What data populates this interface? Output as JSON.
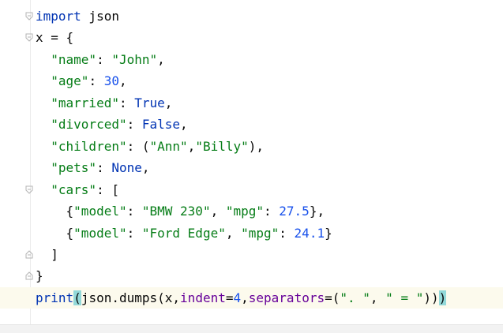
{
  "code_lines": [
    "import json",
    "x = {",
    "  \"name\": \"John\",",
    "  \"age\": 30,",
    "  \"married\": True,",
    "  \"divorced\": False,",
    "  \"children\": (\"Ann\",\"Billy\"),",
    "  \"pets\": None,",
    "  \"cars\": [",
    "    {\"model\": \"BMW 230\", \"mpg\": 27.5},",
    "    {\"model\": \"Ford Edge\", \"mpg\": 24.1}",
    "  ]",
    "}",
    "print(json.dumps(x,indent=4,separators=(\". \", \" = \")))"
  ],
  "tokens": {
    "import_kw": "import",
    "json_mod": " json",
    "x_assign": "x = {",
    "indent2": "  ",
    "indent4": "    ",
    "k_name": "\"name\"",
    "v_name": "\"John\"",
    "k_age": "\"age\"",
    "v_age": "30",
    "k_married": "\"married\"",
    "v_married": "True",
    "k_divorced": "\"divorced\"",
    "v_divorced": "False",
    "k_children": "\"children\"",
    "v_child1": "\"Ann\"",
    "v_child2": "\"Billy\"",
    "k_pets": "\"pets\"",
    "v_pets": "None",
    "k_cars": "\"cars\"",
    "k_model": "\"model\"",
    "v_model1": "\"BMW 230\"",
    "v_model2": "\"Ford Edge\"",
    "k_mpg": "\"mpg\"",
    "v_mpg1": "27.5",
    "v_mpg2": "24.1",
    "colon": ": ",
    "comma": ",",
    "comma_sp": ", ",
    "open_paren": "(",
    "close_paren": ")",
    "open_brace": "{",
    "close_brace": "}",
    "open_bracket": "[",
    "close_bracket": "]",
    "print_fn": "print",
    "dumps_call": "json.dumps(x,",
    "indent_param": "indent",
    "eq": "=",
    "indent_val": "4",
    "sep_param": "separators",
    "sep1": "\". \"",
    "sep2": "\" = \"",
    "close_tail": "))"
  },
  "colors": {
    "keyword": "#0033b3",
    "string": "#067d17",
    "number": "#1750eb",
    "named_param": "#660099",
    "current_line": "#fcfaed",
    "brace_match": "#93d9d9"
  },
  "icons": {
    "fold_open": "fold-open-icon",
    "fold_close": "fold-close-icon"
  }
}
